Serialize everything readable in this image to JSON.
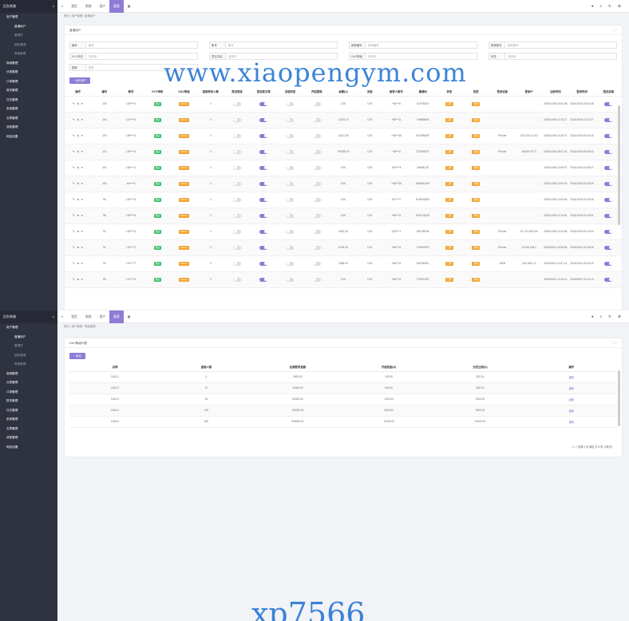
{
  "app": {
    "brand": "后台系统",
    "tabs": [
      "首页",
      "系统",
      "用户",
      "管理"
    ],
    "active_tab": "管理"
  },
  "sidebar": {
    "items": [
      {
        "label": "用户管理",
        "kind": "group"
      },
      {
        "label": "普通用户",
        "kind": "sub"
      },
      {
        "label": "管理员",
        "kind": "sub"
      },
      {
        "label": "团队管理",
        "kind": "sub"
      },
      {
        "label": "等级管理",
        "kind": "sub"
      },
      {
        "label": "商城管理",
        "kind": "group"
      },
      {
        "label": "分类管理",
        "kind": "group"
      },
      {
        "label": "订单管理",
        "kind": "group"
      },
      {
        "label": "财务管理",
        "kind": "group"
      },
      {
        "label": "日志管理",
        "kind": "group"
      },
      {
        "label": "系统管理",
        "kind": "group"
      },
      {
        "label": "文章管理",
        "kind": "group"
      },
      {
        "label": "消息管理",
        "kind": "group"
      },
      {
        "label": "网站设置",
        "kind": "group"
      }
    ]
  },
  "screen1": {
    "breadcrumb": "首页 / 用户管理 / 普通用户",
    "card_title": "普通用户",
    "filters": [
      {
        "label": "编号",
        "placeholder": "编号"
      },
      {
        "label": "账号",
        "placeholder": "账号"
      },
      {
        "label": "推荐编号",
        "placeholder": "推荐编号"
      },
      {
        "label": "推荐账号",
        "placeholder": "推荐账号"
      },
      {
        "label": "KYC状态",
        "placeholder": "请选择"
      },
      {
        "label": "是否冻结",
        "placeholder": "请选择"
      },
      {
        "label": "DAO等级",
        "placeholder": "请选择"
      },
      {
        "label": "状态",
        "placeholder": "请选择"
      },
      {
        "label": "国家",
        "placeholder": "国家"
      }
    ],
    "add_button": "+ 添加用户",
    "columns": [
      "操作",
      "编号",
      "账号",
      "KYC审核",
      "DAO等级",
      "直推有效人数",
      "是否锁定",
      "是否能交易",
      "冻结状态",
      "开启提现",
      "余额(U)",
      "冻结",
      "推荐人账号",
      "邀请码",
      "状态",
      "类型",
      "登录设备",
      "登录IP",
      "注册时间",
      "登录时间",
      "是否启用"
    ],
    "rows": [
      {
        "id": "105",
        "account": "126****4",
        "kyc": "通过",
        "dao": "DAO-1",
        "direct": "0",
        "balance": "0.00",
        "frozen": "0.00",
        "ref": "+66***5",
        "code": "XLP35GDI",
        "status": "正常",
        "type": "普通",
        "device": "",
        "ip": "",
        "reg": "2024/10/18 19:51:48",
        "login": "2024/10/18 19:51:48"
      },
      {
        "id": "104",
        "account": "123****4",
        "kyc": "通过",
        "dao": "DAO-1",
        "direct": "0",
        "balance": "12475.10",
        "frozen": "0.00",
        "ref": "+86***11",
        "code": "Y0M9IBKB",
        "status": "正常",
        "type": "普通",
        "device": "",
        "ip": "",
        "reg": "2024/10/18 12:12:27",
        "login": "2024/10/18 12:12:27"
      },
      {
        "id": "103",
        "account": "198****4",
        "kyc": "通过",
        "dao": "DAO-2",
        "direct": "0",
        "balance": "11101.08",
        "frozen": "0.00",
        "ref": "+66***35",
        "code": "SGVRB5DF",
        "status": "正常",
        "type": "普通",
        "device": "iPhone",
        "ip": "175.100.13.113",
        "reg": "2024/10/18 23:10:37",
        "login": "2024/10/18 00:13:25"
      },
      {
        "id": "102",
        "account": "144****4",
        "kyc": "通过",
        "dao": "DAO-3",
        "direct": "0",
        "balance": "790038.00",
        "frozen": "0.00",
        "ref": "+66***4",
        "code": "TZXN3EDT",
        "status": "正常",
        "type": "普通",
        "device": "iPhone",
        "ip": "156.59.39.77",
        "reg": "2024/10/18 18:47:42",
        "login": "2024/10/18 05:05:42"
      },
      {
        "id": "101",
        "account": "164****1",
        "kyc": "通过",
        "dao": "DAO-1",
        "direct": "0",
        "balance": "0.00",
        "frozen": "0.00",
        "ref": "199****4",
        "code": "ZW6BCJE",
        "status": "正常",
        "type": "普通",
        "device": "",
        "ip": "",
        "reg": "2024/10/18 23:05:37",
        "login": "2024/10/18 23:05:37"
      },
      {
        "id": "100",
        "account": "zw****6",
        "kyc": "通过",
        "dao": "DAO-1",
        "direct": "0",
        "balance": "0.00",
        "frozen": "0.00",
        "ref": "+66***35",
        "code": "DWR9U1HF",
        "status": "正常",
        "type": "普通",
        "device": "",
        "ip": "",
        "reg": "2024/10/18 23:03:29",
        "login": "2024/10/18 23:03:29"
      },
      {
        "id": "99",
        "account": "164****5",
        "kyc": "通过",
        "dao": "DAO-1",
        "direct": "0",
        "balance": "0.00",
        "frozen": "0.00",
        "ref": "157****7",
        "code": "ELNRNE5G",
        "status": "正常",
        "type": "普通",
        "device": "",
        "ip": "",
        "reg": "2024/10/18 23:03:36",
        "login": "2024/10/18 23:03:36"
      },
      {
        "id": "98",
        "account": "193****6",
        "kyc": "通过",
        "dao": "DAO-1",
        "direct": "0",
        "balance": "0.00",
        "frozen": "0.00",
        "ref": "+66***11",
        "code": "AHXYUD2S",
        "status": "正常",
        "type": "普通",
        "device": "",
        "ip": "",
        "reg": "2024/10/18 21:24:51",
        "login": "2024/10/18 21:24:51"
      },
      {
        "id": "92",
        "account": "128****4",
        "kyc": "通过",
        "dao": "DAO-1",
        "direct": "0",
        "balance": "6400.18",
        "frozen": "0.00",
        "ref": "128****1",
        "code": "KB1ZRHM",
        "status": "正常",
        "type": "普通",
        "device": "iPhone",
        "ip": "137.10.255.100",
        "reg": "2024/10/18 23:23:48",
        "login": "2024/10/18 01:12:04"
      },
      {
        "id": "91",
        "account": "132****7",
        "kyc": "通过",
        "dao": "DAO-1",
        "direct": "0",
        "balance": "8745.30",
        "frozen": "0.00",
        "ref": "+66***11",
        "code": "YXN0D9SY",
        "status": "正常",
        "type": "普通",
        "device": "iPhone",
        "ip": "13.228.228.1",
        "reg": "2024/09/11 23:35:58",
        "login": "2024/10/10 21:08:35"
      },
      {
        "id": "90",
        "account": "131****7",
        "kyc": "通过",
        "dao": "DAO-1",
        "direct": "0",
        "balance": "3365.00",
        "frozen": "0.00",
        "ref": "+66***11",
        "code": "Z36TN4RC",
        "status": "正常",
        "type": "普通",
        "device": "WEB",
        "ip": "192.168.1.4",
        "reg": "2024/09/11 12:57:14",
        "login": "2024/10/10 00:42:49"
      },
      {
        "id": "89",
        "account": "137****4",
        "kyc": "通过",
        "dao": "DAO-1",
        "direct": "0",
        "balance": "0.00",
        "frozen": "0.00",
        "ref": "+66***11",
        "code": "7GZS1LEF",
        "status": "正常",
        "type": "普通",
        "device": "",
        "ip": "",
        "reg": "2024/09/12 12:14:13",
        "login": "2024/09/12 12:14:13"
      }
    ],
    "watermark": "www.xiaopengym.com"
  },
  "screen2": {
    "breadcrumb": "首页 / 用户管理 / 等级管理",
    "card_title": "DAO等级列表",
    "add_button": "+ 添加",
    "columns": [
      "名称",
      "直推人数",
      "业绩要求金额",
      "升级奖励(U)",
      "分红比例(U)",
      "操作"
    ],
    "rows": [
      {
        "name": "DAO-1",
        "direct": "4",
        "amount": "3000.00",
        "reward": "100.00",
        "ratio": "200.00",
        "op": "编辑"
      },
      {
        "name": "DAO-2",
        "direct": "12",
        "amount": "15000.00",
        "reward": "500.00",
        "ratio": "500.00",
        "op": "编辑"
      },
      {
        "name": "DAO-3",
        "direct": "30",
        "amount": "50000.00",
        "reward": "1000.00",
        "ratio": "1000.00",
        "op": "编辑"
      },
      {
        "name": "DAO-4",
        "direct": "120",
        "amount": "100000.00",
        "reward": "3000.00",
        "ratio": "3000.00",
        "op": "编辑"
      },
      {
        "name": "DAO-5",
        "direct": "300",
        "amount": "500000.00",
        "reward": "10000.00",
        "ratio": "10000.00",
        "op": "编辑"
      }
    ],
    "pager": "< 1 > 到第 1 页 确定 共 5 条 10条/页",
    "watermark": "xp7566"
  }
}
